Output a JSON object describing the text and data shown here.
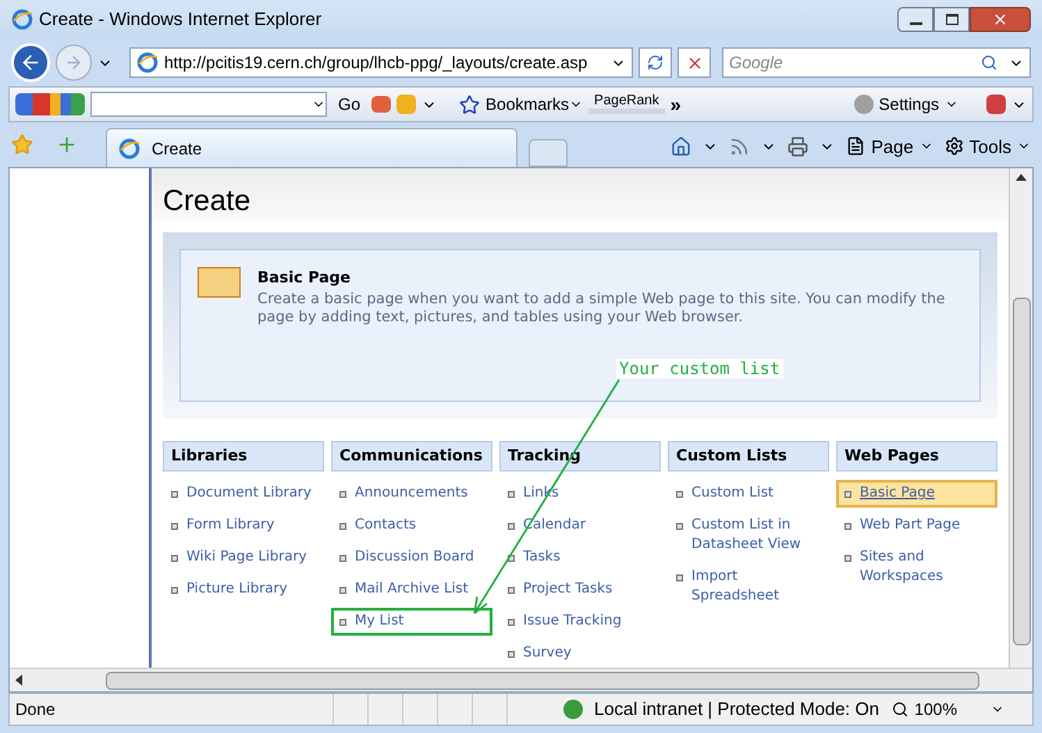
{
  "window": {
    "title": "Create - Windows Internet Explorer"
  },
  "address_bar": {
    "url": "http://pcitis19.cern.ch/group/lhcb-ppg/_layouts/create.asp"
  },
  "search": {
    "placeholder": "Google"
  },
  "google_toolbar": {
    "go": "Go",
    "bookmarks": "Bookmarks",
    "pagerank": "PageRank",
    "more": "»",
    "settings": "Settings"
  },
  "tab": {
    "label": "Create"
  },
  "command_bar": {
    "page": "Page",
    "tools": "Tools"
  },
  "page": {
    "title": "Create",
    "preview": {
      "title": "Basic Page",
      "description": "Create a basic page when you want to add a simple Web page to this site. You can modify the page by adding text, pictures, and tables using your Web browser."
    },
    "annotation": "Your custom list",
    "categories": [
      {
        "title": "Libraries",
        "items": [
          {
            "label": "Document Library",
            "selected": false,
            "annotated": false
          },
          {
            "label": "Form Library",
            "selected": false,
            "annotated": false
          },
          {
            "label": "Wiki Page Library",
            "selected": false,
            "annotated": false
          },
          {
            "label": "Picture Library",
            "selected": false,
            "annotated": false
          }
        ]
      },
      {
        "title": "Communications",
        "items": [
          {
            "label": "Announcements",
            "selected": false,
            "annotated": false
          },
          {
            "label": "Contacts",
            "selected": false,
            "annotated": false
          },
          {
            "label": "Discussion Board",
            "selected": false,
            "annotated": false
          },
          {
            "label": "Mail Archive List",
            "selected": false,
            "annotated": false
          },
          {
            "label": "My List",
            "selected": false,
            "annotated": true
          }
        ]
      },
      {
        "title": "Tracking",
        "items": [
          {
            "label": "Links",
            "selected": false,
            "annotated": false
          },
          {
            "label": "Calendar",
            "selected": false,
            "annotated": false
          },
          {
            "label": "Tasks",
            "selected": false,
            "annotated": false
          },
          {
            "label": "Project Tasks",
            "selected": false,
            "annotated": false
          },
          {
            "label": "Issue Tracking",
            "selected": false,
            "annotated": false
          },
          {
            "label": "Survey",
            "selected": false,
            "annotated": false
          }
        ]
      },
      {
        "title": "Custom Lists",
        "items": [
          {
            "label": "Custom List",
            "selected": false,
            "annotated": false
          },
          {
            "label": "Custom List in Datasheet View",
            "selected": false,
            "annotated": false
          },
          {
            "label": "Import Spreadsheet",
            "selected": false,
            "annotated": false
          }
        ]
      },
      {
        "title": "Web Pages",
        "items": [
          {
            "label": "Basic Page",
            "selected": true,
            "annotated": false
          },
          {
            "label": "Web Part Page",
            "selected": false,
            "annotated": false
          },
          {
            "label": "Sites and Workspaces",
            "selected": false,
            "annotated": false
          }
        ]
      }
    ]
  },
  "status_bar": {
    "status": "Done",
    "zone": "Local intranet | Protected Mode: On",
    "zoom": "100%"
  }
}
